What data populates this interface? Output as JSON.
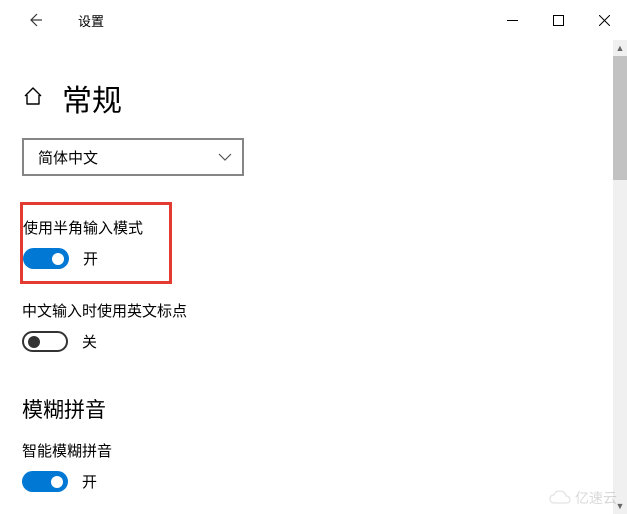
{
  "titlebar": {
    "title": "设置"
  },
  "page": {
    "title": "常规"
  },
  "dropdown": {
    "selected": "简体中文"
  },
  "settings": {
    "halfwidth": {
      "label": "使用半角输入模式",
      "state_text": "开",
      "on": true
    },
    "english_punct": {
      "label": "中文输入时使用英文标点",
      "state_text": "关",
      "on": false
    }
  },
  "section": {
    "fuzzy_title": "模糊拼音",
    "smart_fuzzy": {
      "label": "智能模糊拼音",
      "state_text": "开",
      "on": true
    }
  },
  "watermark": {
    "text": "亿速云"
  }
}
